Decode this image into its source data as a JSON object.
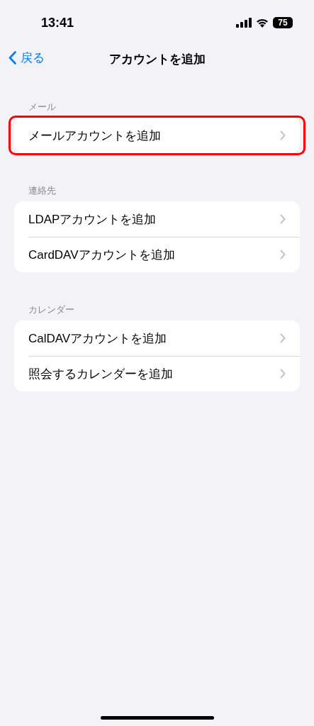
{
  "status_bar": {
    "time": "13:41",
    "battery": "75"
  },
  "nav": {
    "back": "戻る",
    "title": "アカウントを追加"
  },
  "sections": [
    {
      "header": "メール",
      "rows": [
        {
          "label": "メールアカウントを追加",
          "highlighted": true
        }
      ]
    },
    {
      "header": "連絡先",
      "rows": [
        {
          "label": "LDAPアカウントを追加",
          "highlighted": false
        },
        {
          "label": "CardDAVアカウントを追加",
          "highlighted": false
        }
      ]
    },
    {
      "header": "カレンダー",
      "rows": [
        {
          "label": "CalDAVアカウントを追加",
          "highlighted": false
        },
        {
          "label": "照会するカレンダーを追加",
          "highlighted": false
        }
      ]
    }
  ]
}
